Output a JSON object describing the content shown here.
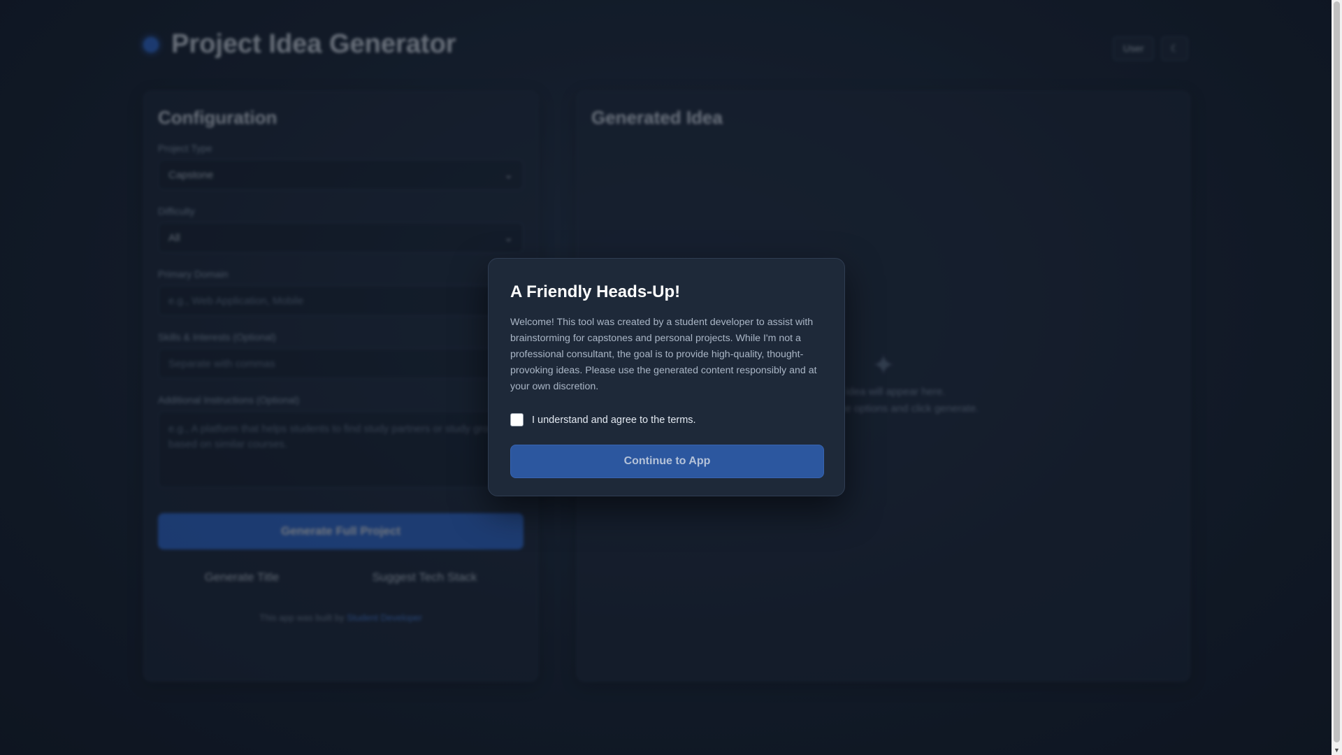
{
  "app": {
    "title": "Project Idea Generator",
    "header_chip": "User",
    "header_icon": "moon-icon"
  },
  "config": {
    "heading": "Configuration",
    "fields": [
      {
        "label": "Project Type",
        "value": "Capstone"
      },
      {
        "label": "Difficulty",
        "value": "All"
      },
      {
        "label": "Primary Domain",
        "value": "e.g., Web Application, Mobile"
      },
      {
        "label": "Skills & Interests (Optional)",
        "value": "Separate with commas"
      },
      {
        "label": "Additional Instructions (Optional)",
        "value": "e.g., A platform that helps students to find study partners or study groups based on similar courses."
      }
    ],
    "primary_button": "Generate Full Project",
    "secondary_buttons": [
      "Generate Title",
      "Suggest Tech Stack"
    ],
    "footer_prefix": "This app was built by",
    "footer_link": "Student Developer"
  },
  "output": {
    "heading": "Generated Idea",
    "empty_line1": "Your idea will appear here.",
    "empty_line2": "Configure the options and click generate."
  },
  "modal": {
    "title": "A Friendly Heads-Up!",
    "body": "Welcome! This tool was created by a student developer to assist with brainstorming for capstones and personal projects. While I'm not a professional consultant, the goal is to provide high-quality, thought-provoking ideas. Please use the generated content responsibly and at your own discretion.",
    "checkbox_label": "I understand and agree to the terms.",
    "checkbox_checked": false,
    "button": "Continue to App"
  },
  "colors": {
    "accent": "#2f6fe0",
    "background": "#141e2d",
    "modal_bg": "#1e2939"
  }
}
